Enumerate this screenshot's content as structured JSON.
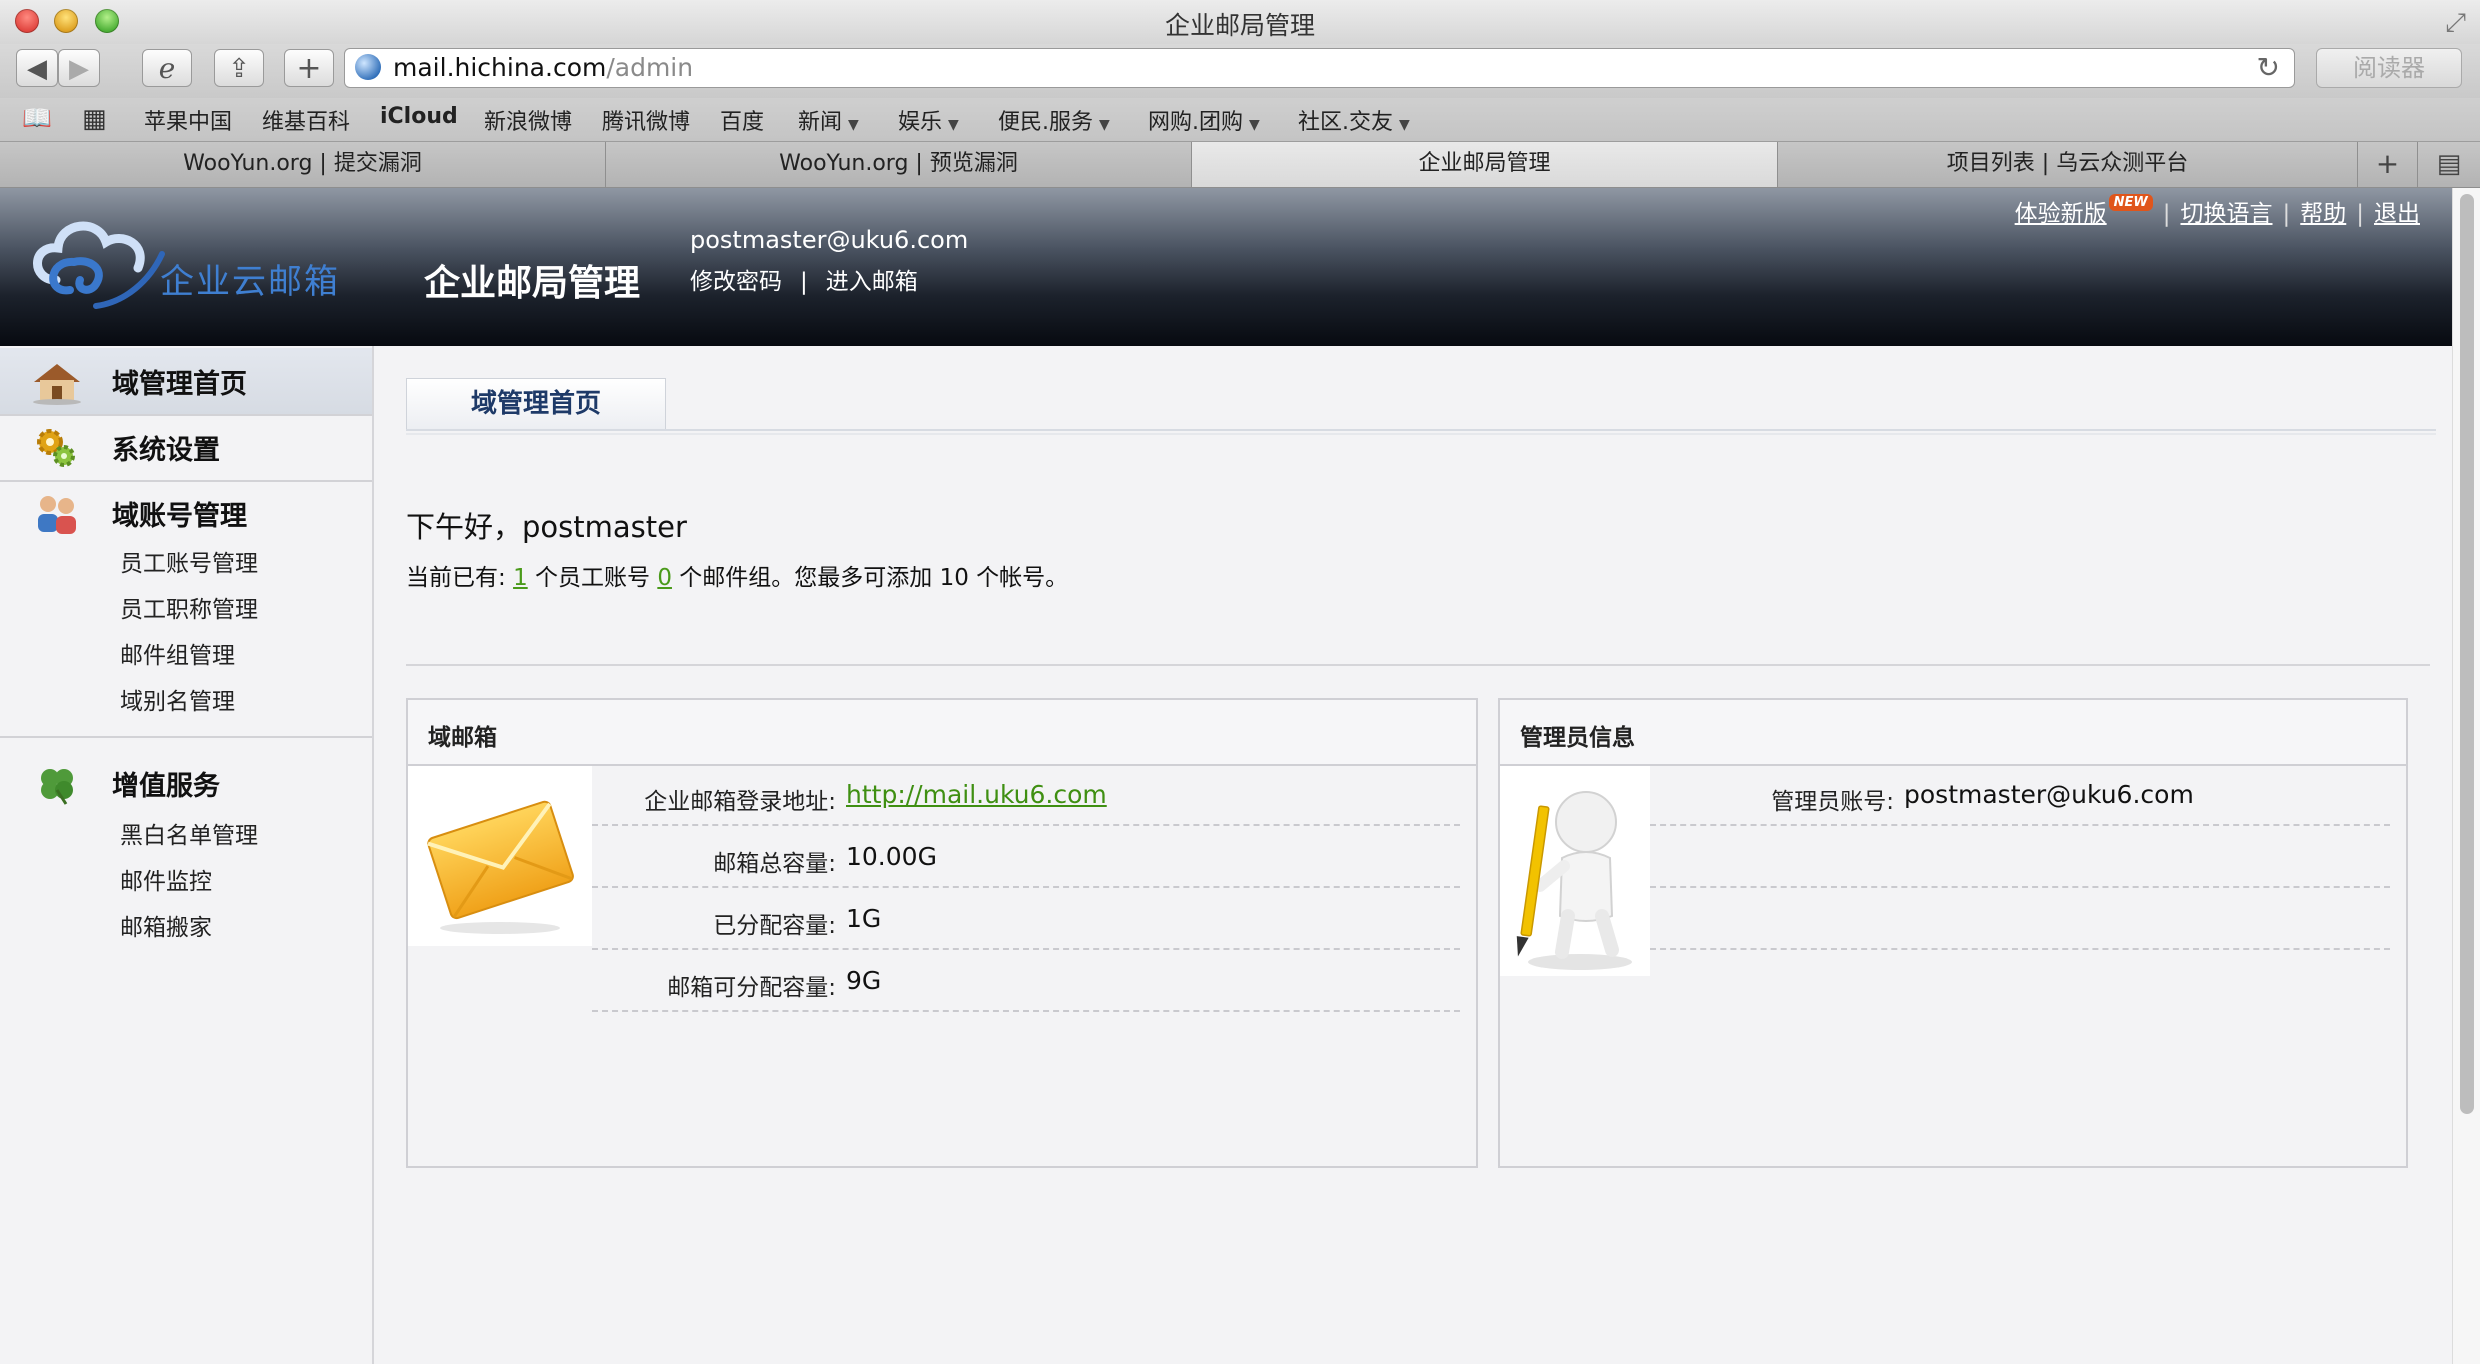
{
  "window": {
    "title": "企业邮局管理"
  },
  "browser": {
    "url_host": "mail.hichina.com",
    "url_path": "/admin",
    "reader_label": "阅读器",
    "bookmarks": [
      "苹果中国",
      "维基百科",
      "iCloud",
      "新浪微博",
      "腾讯微博",
      "百度",
      "新闻",
      "娱乐",
      "便民.服务",
      "网购.团购",
      "社区.交友"
    ],
    "tabs": [
      {
        "label": "WooYun.org | 提交漏洞",
        "active": false
      },
      {
        "label": "WooYun.org | 预览漏洞",
        "active": false
      },
      {
        "label": "企业邮局管理",
        "active": true
      },
      {
        "label": "项目列表 | 乌云众测平台",
        "active": false
      }
    ]
  },
  "header": {
    "logo_text": "企业云邮箱",
    "title": "企业邮局管理",
    "user_email": "postmaster@uku6.com",
    "change_password": "修改密码",
    "link_sep": "|",
    "enter_mailbox": "进入邮箱",
    "top_links": {
      "try_new": "体验新版",
      "new_badge": "NEW",
      "switch_lang": "切换语言",
      "help": "帮助",
      "logout": "退出"
    }
  },
  "sidebar": {
    "home": "域管理首页",
    "settings": "系统设置",
    "accounts": "域账号管理",
    "accounts_items": [
      "员工账号管理",
      "员工职称管理",
      "邮件组管理",
      "域别名管理"
    ],
    "services": "增值服务",
    "services_items": [
      "黑白名单管理",
      "邮件监控",
      "邮箱搬家"
    ]
  },
  "main": {
    "tab_label": "域管理首页",
    "greeting": "下午好，postmaster",
    "summary": {
      "prefix": "当前已有: ",
      "employee_count": "1",
      "mid1": " 个员工账号 ",
      "group_count": "0",
      "mid2": " 个邮件组。您最多可添加 ",
      "max": "10",
      "suffix": " 个帐号。"
    },
    "domain_panel": {
      "title": "域邮箱",
      "rows": [
        {
          "label": "企业邮箱登录地址:",
          "value": "http://mail.uku6.com"
        },
        {
          "label": "邮箱总容量:",
          "value": "10.00G"
        },
        {
          "label": "已分配容量:",
          "value": "1G"
        },
        {
          "label": "邮箱可分配容量:",
          "value": "9G"
        }
      ]
    },
    "admin_panel": {
      "title": "管理员信息",
      "rows": [
        {
          "label": "管理员账号:",
          "value": "postmaster@uku6.com"
        },
        {
          "label": "",
          "value": ""
        },
        {
          "label": "",
          "value": ""
        }
      ]
    }
  },
  "colors": {
    "link_green": "#3f8f12",
    "header_dark": "#070a10",
    "tab_title_blue": "#1e3a68",
    "badge_orange": "#e0551b"
  }
}
